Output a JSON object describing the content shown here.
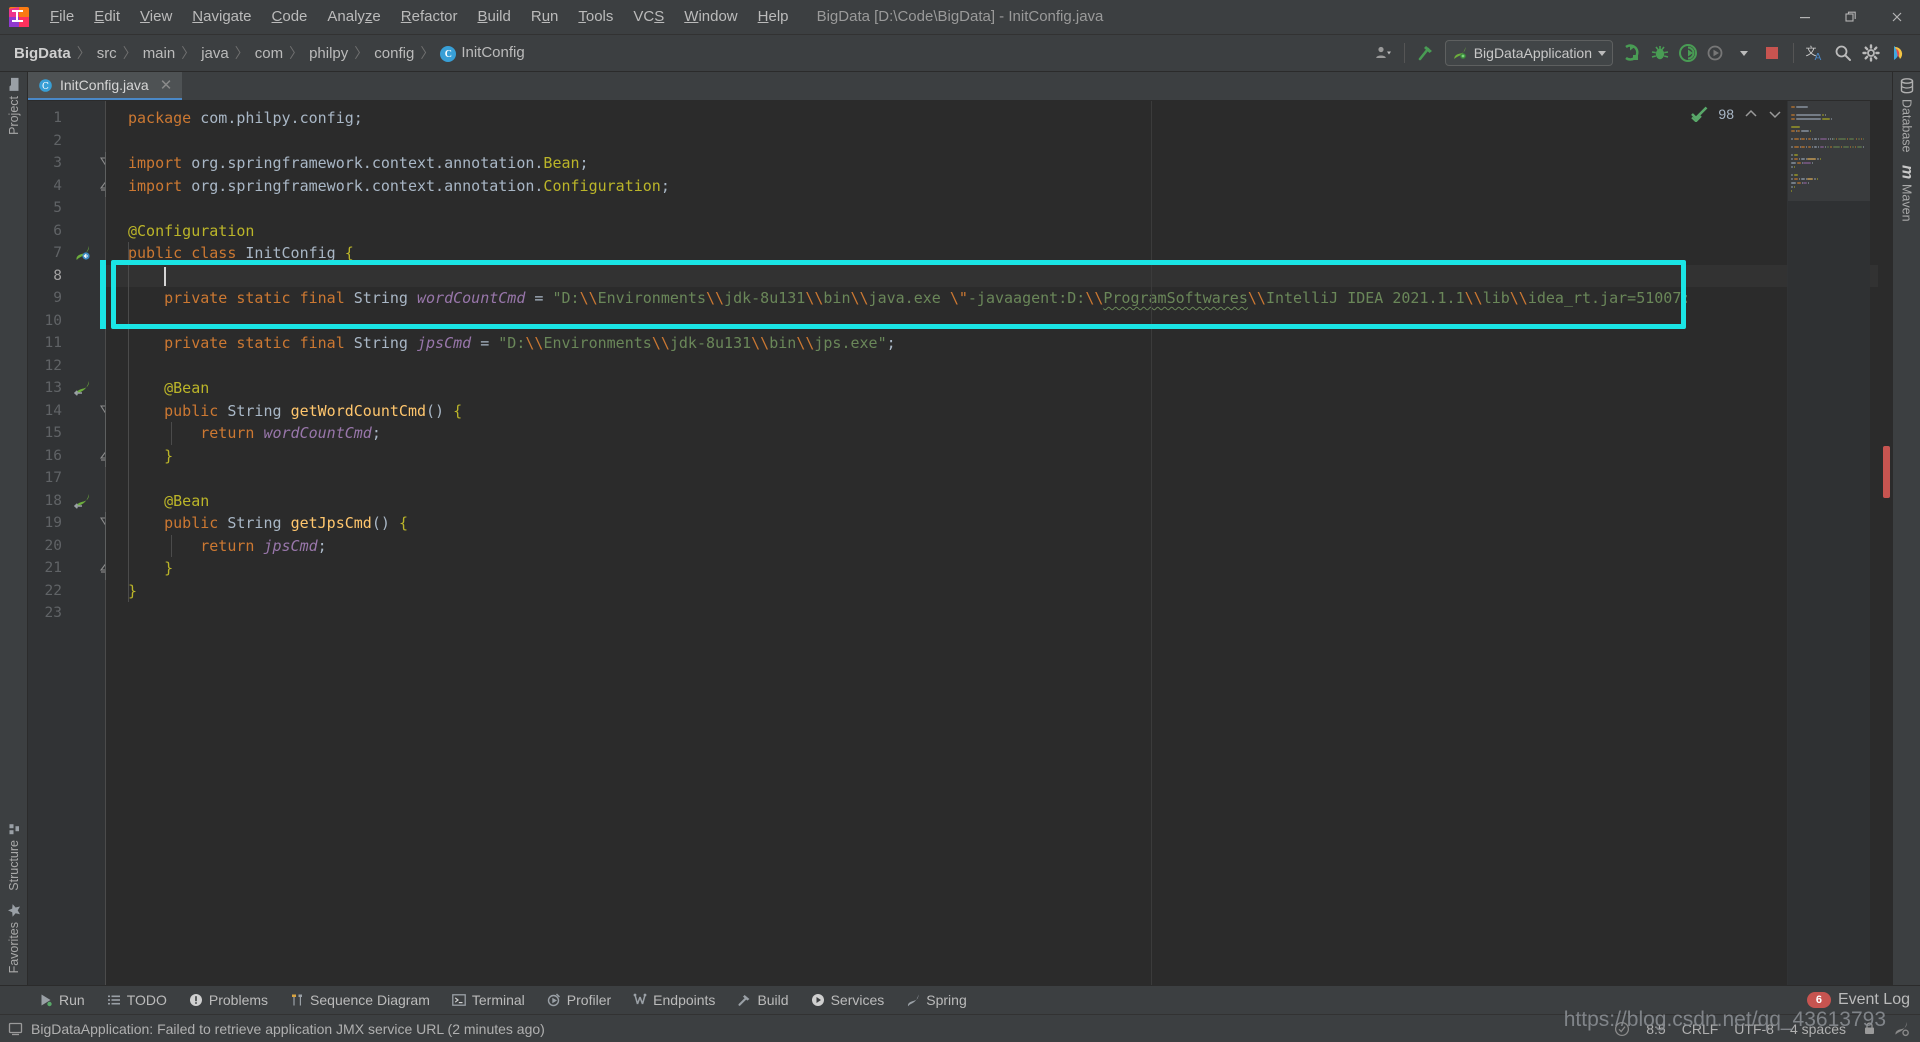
{
  "window": {
    "title": "BigData [D:\\Code\\BigData] - InitConfig.java",
    "minimize": "—",
    "maximize": "❐",
    "close": "✕"
  },
  "menu": [
    {
      "label": "File",
      "mnemonic": "F"
    },
    {
      "label": "Edit",
      "mnemonic": "E"
    },
    {
      "label": "View",
      "mnemonic": "V"
    },
    {
      "label": "Navigate",
      "mnemonic": "N"
    },
    {
      "label": "Code",
      "mnemonic": "C"
    },
    {
      "label": "Analyze",
      "mnemonic": "z"
    },
    {
      "label": "Refactor",
      "mnemonic": "R"
    },
    {
      "label": "Build",
      "mnemonic": "B"
    },
    {
      "label": "Run",
      "mnemonic": "u"
    },
    {
      "label": "Tools",
      "mnemonic": "T"
    },
    {
      "label": "VCS",
      "mnemonic": "S"
    },
    {
      "label": "Window",
      "mnemonic": "W"
    },
    {
      "label": "Help",
      "mnemonic": "H"
    }
  ],
  "breadcrumbs": [
    {
      "label": "BigData",
      "bold": true
    },
    {
      "label": "src",
      "bold": false
    },
    {
      "label": "main",
      "bold": false
    },
    {
      "label": "java",
      "bold": false
    },
    {
      "label": "com",
      "bold": false
    },
    {
      "label": "philpy",
      "bold": false
    },
    {
      "label": "config",
      "bold": false
    },
    {
      "label": "InitConfig",
      "bold": false,
      "badge": "C"
    }
  ],
  "toolbar": {
    "run_config": "BigDataApplication",
    "icons": [
      "user-avatar-icon",
      "hammer-build-icon",
      "run-icon",
      "debug-icon",
      "run-with-coverage-icon",
      "profile-icon",
      "stop-icon",
      "translate-icon",
      "search-everywhere-icon",
      "settings-gear-icon",
      "ide-features-icon"
    ]
  },
  "tabs": [
    {
      "label": "InitConfig.java",
      "icon": "java-class-icon",
      "close": "✕",
      "active": true
    }
  ],
  "left_tool_window": [
    {
      "label": "Project",
      "icon": "folder-icon"
    },
    {
      "label": "Structure",
      "icon": "structure-icon"
    },
    {
      "label": "Favorites",
      "icon": "star-icon"
    }
  ],
  "right_tool_window": [
    {
      "label": "Database",
      "icon": "database-icon"
    },
    {
      "label": "Maven",
      "icon": "maven-m-icon"
    }
  ],
  "inspections": {
    "count": "98",
    "status_icon": "inspection-ok-checkmark",
    "prev": "⌃",
    "next": "⌄"
  },
  "editor": {
    "current_line": 8,
    "total_lines": 23,
    "highlight_box_color": "#1ae5e5",
    "lines": [
      {
        "n": 1,
        "tokens": [
          {
            "t": "package",
            "c": "kw"
          },
          {
            "t": " com.philpy.config;",
            "c": "plain"
          }
        ]
      },
      {
        "n": 2,
        "tokens": []
      },
      {
        "n": 3,
        "tokens": [
          {
            "t": "import",
            "c": "kw"
          },
          {
            "t": " org.springframework.context.annotation.",
            "c": "plain"
          },
          {
            "t": "Bean",
            "c": "ann"
          },
          {
            "t": ";",
            "c": "plain"
          }
        ],
        "fold": "open"
      },
      {
        "n": 4,
        "tokens": [
          {
            "t": "import",
            "c": "kw"
          },
          {
            "t": " org.springframework.context.annotation.",
            "c": "plain"
          },
          {
            "t": "Configuration",
            "c": "ann"
          },
          {
            "t": ";",
            "c": "plain"
          }
        ],
        "fold": "end"
      },
      {
        "n": 5,
        "tokens": []
      },
      {
        "n": 6,
        "tokens": [
          {
            "t": "@Configuration",
            "c": "ann"
          }
        ]
      },
      {
        "n": 7,
        "tokens": [
          {
            "t": "public",
            "c": "kw"
          },
          {
            "t": " ",
            "c": "plain"
          },
          {
            "t": "class",
            "c": "kw"
          },
          {
            "t": " InitConfig ",
            "c": "cls"
          },
          {
            "t": "{",
            "c": "ann"
          }
        ],
        "gutter_icon": "spring-bean-icon"
      },
      {
        "n": 8,
        "tokens": [],
        "current": true
      },
      {
        "n": 9,
        "tokens": [
          {
            "t": "    ",
            "c": "plain"
          },
          {
            "t": "private",
            "c": "kw"
          },
          {
            "t": " ",
            "c": "plain"
          },
          {
            "t": "static",
            "c": "kw"
          },
          {
            "t": " ",
            "c": "plain"
          },
          {
            "t": "final",
            "c": "kw"
          },
          {
            "t": " ",
            "c": "plain"
          },
          {
            "t": "String",
            "c": "cls"
          },
          {
            "t": " ",
            "c": "plain"
          },
          {
            "t": "wordCountCmd",
            "c": "fld"
          },
          {
            "t": " ",
            "c": "plain"
          },
          {
            "t": "=",
            "c": "plain"
          },
          {
            "t": " ",
            "c": "plain"
          },
          {
            "t": "\"D:",
            "c": "str"
          },
          {
            "t": "\\\\",
            "c": "esc"
          },
          {
            "t": "Environments",
            "c": "str"
          },
          {
            "t": "\\\\",
            "c": "esc"
          },
          {
            "t": "jdk-8u131",
            "c": "str"
          },
          {
            "t": "\\\\",
            "c": "esc"
          },
          {
            "t": "bin",
            "c": "esc2"
          },
          {
            "t": "\\\\",
            "c": "esc"
          },
          {
            "t": "java.exe ",
            "c": "str"
          },
          {
            "t": "\\\"",
            "c": "esc"
          },
          {
            "t": "-javaagent:D:",
            "c": "str"
          },
          {
            "t": "\\\\",
            "c": "esc"
          },
          {
            "t": "ProgramSoftwares",
            "c": "str-typo"
          },
          {
            "t": "\\\\",
            "c": "esc"
          },
          {
            "t": "IntelliJ IDEA 2021.1.1",
            "c": "str"
          },
          {
            "t": "\\\\",
            "c": "esc"
          },
          {
            "t": "lib",
            "c": "str"
          },
          {
            "t": "\\\\",
            "c": "esc"
          },
          {
            "t": "idea_rt.jar=51007:",
            "c": "str"
          }
        ]
      },
      {
        "n": 10,
        "tokens": []
      },
      {
        "n": 11,
        "tokens": [
          {
            "t": "    ",
            "c": "plain"
          },
          {
            "t": "private",
            "c": "kw"
          },
          {
            "t": " ",
            "c": "plain"
          },
          {
            "t": "static",
            "c": "kw"
          },
          {
            "t": " ",
            "c": "plain"
          },
          {
            "t": "final",
            "c": "kw"
          },
          {
            "t": " ",
            "c": "plain"
          },
          {
            "t": "String",
            "c": "cls"
          },
          {
            "t": " ",
            "c": "plain"
          },
          {
            "t": "jpsCmd",
            "c": "fld"
          },
          {
            "t": " = ",
            "c": "plain"
          },
          {
            "t": "\"D:",
            "c": "str"
          },
          {
            "t": "\\\\",
            "c": "esc"
          },
          {
            "t": "Environments",
            "c": "str"
          },
          {
            "t": "\\\\",
            "c": "esc"
          },
          {
            "t": "jdk-8u131",
            "c": "str"
          },
          {
            "t": "\\\\",
            "c": "esc"
          },
          {
            "t": "bin",
            "c": "str"
          },
          {
            "t": "\\\\",
            "c": "esc"
          },
          {
            "t": "jps.exe\"",
            "c": "str"
          },
          {
            "t": ";",
            "c": "plain"
          }
        ]
      },
      {
        "n": 12,
        "tokens": []
      },
      {
        "n": 13,
        "tokens": [
          {
            "t": "    ",
            "c": "plain"
          },
          {
            "t": "@Bean",
            "c": "ann"
          }
        ],
        "gutter_icon": "spring-bean-arrow-icon"
      },
      {
        "n": 14,
        "tokens": [
          {
            "t": "    ",
            "c": "plain"
          },
          {
            "t": "public",
            "c": "kw"
          },
          {
            "t": " ",
            "c": "plain"
          },
          {
            "t": "String",
            "c": "cls"
          },
          {
            "t": " ",
            "c": "plain"
          },
          {
            "t": "getWordCountCmd",
            "c": "meth"
          },
          {
            "t": "() ",
            "c": "plain"
          },
          {
            "t": "{",
            "c": "ann"
          }
        ],
        "fold": "open"
      },
      {
        "n": 15,
        "tokens": [
          {
            "t": "        ",
            "c": "plain"
          },
          {
            "t": "return",
            "c": "kw"
          },
          {
            "t": " ",
            "c": "plain"
          },
          {
            "t": "wordCountCmd",
            "c": "fld"
          },
          {
            "t": ";",
            "c": "plain"
          }
        ]
      },
      {
        "n": 16,
        "tokens": [
          {
            "t": "    ",
            "c": "plain"
          },
          {
            "t": "}",
            "c": "ann"
          }
        ],
        "fold": "end"
      },
      {
        "n": 17,
        "tokens": []
      },
      {
        "n": 18,
        "tokens": [
          {
            "t": "    ",
            "c": "plain"
          },
          {
            "t": "@Bean",
            "c": "ann"
          }
        ],
        "gutter_icon": "spring-bean-arrow-icon"
      },
      {
        "n": 19,
        "tokens": [
          {
            "t": "    ",
            "c": "plain"
          },
          {
            "t": "public",
            "c": "kw"
          },
          {
            "t": " ",
            "c": "plain"
          },
          {
            "t": "String",
            "c": "cls"
          },
          {
            "t": " ",
            "c": "plain"
          },
          {
            "t": "getJpsCmd",
            "c": "meth"
          },
          {
            "t": "() ",
            "c": "plain"
          },
          {
            "t": "{",
            "c": "ann"
          }
        ],
        "fold": "open"
      },
      {
        "n": 20,
        "tokens": [
          {
            "t": "        ",
            "c": "plain"
          },
          {
            "t": "return",
            "c": "kw"
          },
          {
            "t": " ",
            "c": "plain"
          },
          {
            "t": "jpsCmd",
            "c": "fld"
          },
          {
            "t": ";",
            "c": "plain"
          }
        ]
      },
      {
        "n": 21,
        "tokens": [
          {
            "t": "    ",
            "c": "plain"
          },
          {
            "t": "}",
            "c": "ann"
          }
        ],
        "fold": "end"
      },
      {
        "n": 22,
        "tokens": [
          {
            "t": "}",
            "c": "ann"
          }
        ]
      },
      {
        "n": 23,
        "tokens": []
      }
    ]
  },
  "bottom_tool_windows": [
    {
      "label": "Run",
      "icon": "run-triangle-icon"
    },
    {
      "label": "TODO",
      "icon": "todo-list-icon"
    },
    {
      "label": "Problems",
      "icon": "problems-icon"
    },
    {
      "label": "Sequence Diagram",
      "icon": "sequence-diagram-icon"
    },
    {
      "label": "Terminal",
      "icon": "terminal-icon"
    },
    {
      "label": "Profiler",
      "icon": "profiler-icon"
    },
    {
      "label": "Endpoints",
      "icon": "endpoints-icon"
    },
    {
      "label": "Build",
      "icon": "build-hammer-icon"
    },
    {
      "label": "Services",
      "icon": "services-icon"
    },
    {
      "label": "Spring",
      "icon": "spring-leaf-icon"
    }
  ],
  "event_log": {
    "label": "Event Log",
    "count": "6"
  },
  "status": {
    "message": "BigDataApplication: Failed to retrieve application JMX service URL (2 minutes ago)",
    "message_icon": "notification-icon",
    "caret_position": "8:5",
    "line_separator": "CRLF",
    "encoding": "UTF-8",
    "indent": "4 spaces",
    "lock_icon": "read-only-lock-icon",
    "inspection_icon": "inspection-profile-icon"
  },
  "watermark": "https://blog.csdn.net/qq_43613793"
}
